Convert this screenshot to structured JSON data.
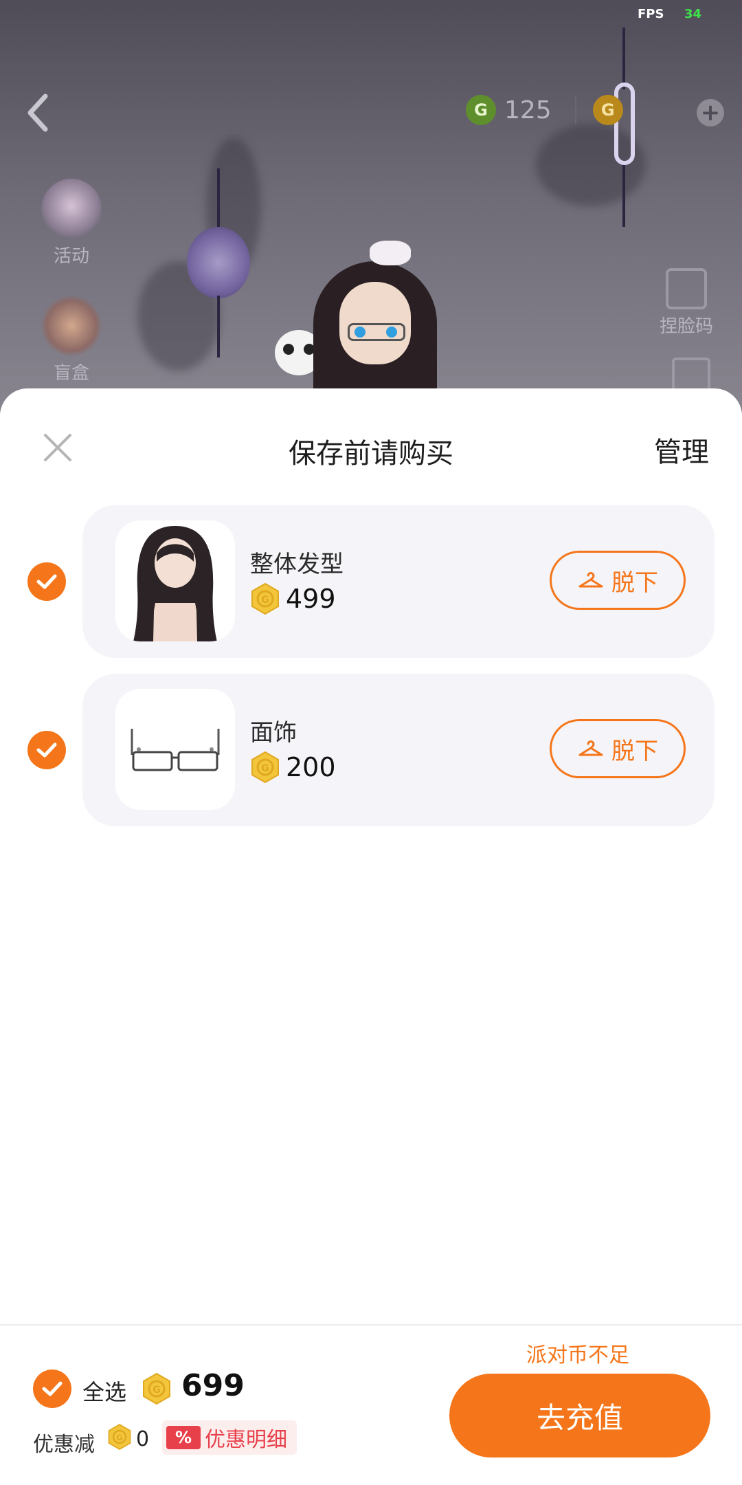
{
  "status": {
    "fps_label": "FPS",
    "fps_value": "34"
  },
  "topbar": {
    "green_coin_value": "125"
  },
  "side": {
    "activity_label": "活动",
    "blindbox_label": "盲盒",
    "face_code_label": "捏脸码"
  },
  "sheet": {
    "title": "保存前请购买",
    "manage_label": "管理",
    "items": [
      {
        "name": "整体发型",
        "price": "499",
        "takeoff_label": "脱下",
        "checked": true,
        "icon": "hair-icon"
      },
      {
        "name": "面饰",
        "price": "200",
        "takeoff_label": "脱下",
        "checked": true,
        "icon": "glasses-icon"
      }
    ]
  },
  "footer": {
    "insufficient_text": "派对币不足",
    "select_all_label": "全选",
    "total": "699",
    "discount_label": "优惠减",
    "discount_value": "0",
    "discount_badge": "%",
    "discount_detail_label": "优惠明细",
    "recharge_label": "去充值"
  },
  "colors": {
    "accent": "#f5761a",
    "coin_gold": "#f2c53a",
    "discount_red": "#e8404a"
  }
}
